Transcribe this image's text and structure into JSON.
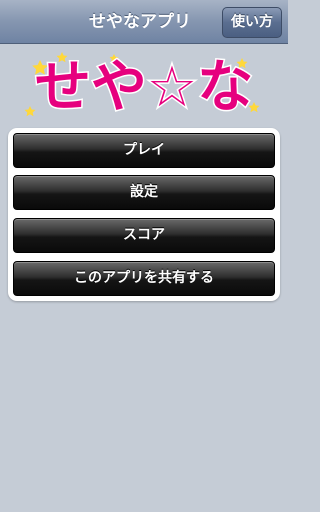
{
  "header": {
    "title": "せやなアプリ",
    "help_button": "使い方"
  },
  "logo": {
    "text": "せや☆な",
    "colors": {
      "fill": "#e6007e",
      "stroke": "#ffffff",
      "star": "#ffd83a"
    }
  },
  "menu": {
    "items": [
      {
        "label": "プレイ"
      },
      {
        "label": "設定"
      },
      {
        "label": "スコア"
      },
      {
        "label": "このアプリを共有する"
      }
    ]
  }
}
